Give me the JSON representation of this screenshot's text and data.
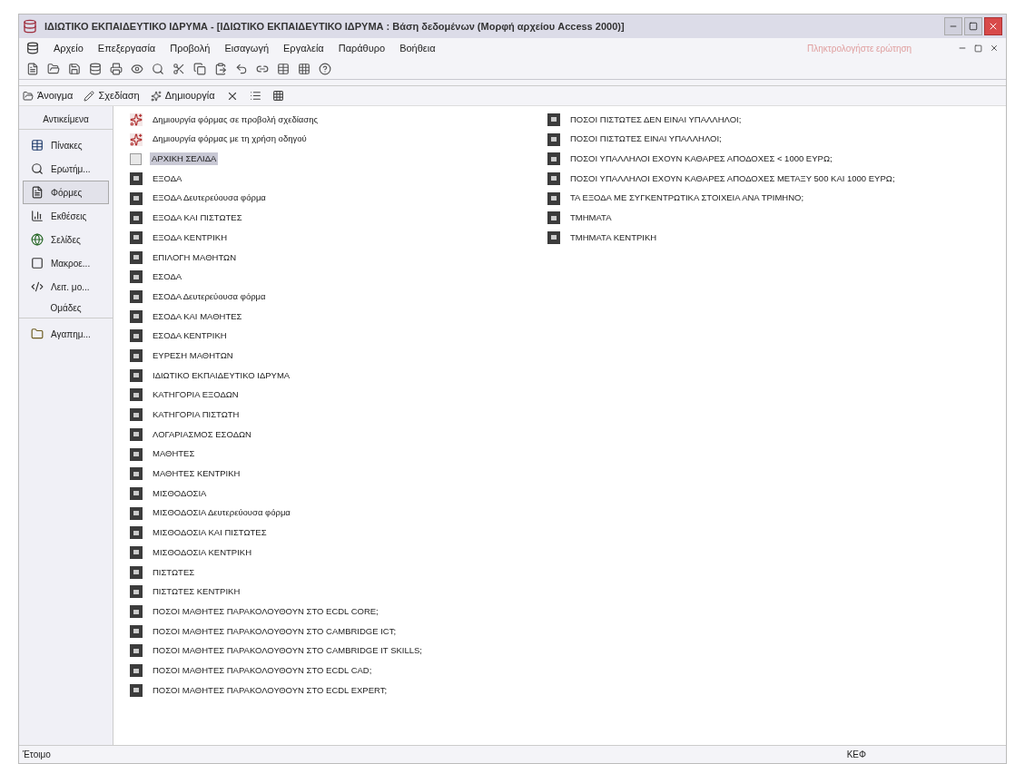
{
  "window": {
    "title": "ΙΔΙΩΤΙΚΟ ΕΚΠΑΙΔΕΥΤΙΚΟ ΙΔΡΥΜΑ - [ΙΔΙΩΤΙΚΟ ΕΚΠΑΙΔΕΥΤΙΚΟ ΙΔΡΥΜΑ : Βάση δεδομένων (Μορφή αρχείου Access 2000)]"
  },
  "menu": [
    "Αρχείο",
    "Επεξεργασία",
    "Προβολή",
    "Εισαγωγή",
    "Εργαλεία",
    "Παράθυρο",
    "Βοήθεια"
  ],
  "help_box": {
    "placeholder": "Πληκτρολογήστε ερώτηση"
  },
  "db_toolbar": [
    {
      "label": "Άνοιγμα",
      "kind": "open"
    },
    {
      "label": "Σχεδίαση",
      "kind": "design"
    },
    {
      "label": "Δημιουργία",
      "kind": "new"
    }
  ],
  "sidebar": [
    {
      "kind": "header",
      "label": "Αντικείμενα"
    },
    {
      "kind": "tables",
      "label": "Πίνακες",
      "selected": false
    },
    {
      "kind": "queries",
      "label": "Ερωτήμ...",
      "selected": false
    },
    {
      "kind": "forms",
      "label": "Φόρμες",
      "selected": true
    },
    {
      "kind": "reports",
      "label": "Εκθέσεις",
      "selected": false
    },
    {
      "kind": "pages",
      "label": "Σελίδες",
      "selected": false
    },
    {
      "kind": "macros",
      "label": "Μακροε...",
      "selected": false
    },
    {
      "kind": "modules",
      "label": "Λειτ. μο...",
      "selected": false
    },
    {
      "kind": "header",
      "label": "Ομάδες"
    },
    {
      "kind": "favorites",
      "label": "Αγαπημ...",
      "selected": false
    }
  ],
  "objects": [
    {
      "kind": "wizard",
      "label": "Δημιουργία φόρμας σε προβολή σχεδίασης",
      "selected": false
    },
    {
      "kind": "wizard",
      "label": "Δημιουργία φόρμας με τη χρήση οδηγού",
      "selected": false
    },
    {
      "kind": "switchboard",
      "label": "ΑΡΧΙΚΗ ΣΕΛΙΔΑ",
      "selected": true
    },
    {
      "kind": "form",
      "label": "ΕΞΟΔΑ",
      "selected": false
    },
    {
      "kind": "form",
      "label": "ΕΞΟΔΑ Δευτερεύουσα φόρμα",
      "selected": false
    },
    {
      "kind": "form",
      "label": "ΕΞΟΔΑ ΚΑΙ ΠΙΣΤΩΤΕΣ",
      "selected": false
    },
    {
      "kind": "form",
      "label": "ΕΞΟΔΑ ΚΕΝΤΡΙΚΗ",
      "selected": false
    },
    {
      "kind": "form",
      "label": "ΕΠΙΛΟΓΗ ΜΑΘΗΤΩΝ",
      "selected": false
    },
    {
      "kind": "form",
      "label": "ΕΣΟΔΑ",
      "selected": false
    },
    {
      "kind": "form",
      "label": "ΕΣΟΔΑ Δευτερεύουσα φόρμα",
      "selected": false
    },
    {
      "kind": "form",
      "label": "ΕΣΟΔΑ ΚΑΙ ΜΑΘΗΤΕΣ",
      "selected": false
    },
    {
      "kind": "form",
      "label": "ΕΣΟΔΑ ΚΕΝΤΡΙΚΗ",
      "selected": false
    },
    {
      "kind": "form",
      "label": "ΕΥΡΕΣΗ ΜΑΘΗΤΩΝ",
      "selected": false
    },
    {
      "kind": "form",
      "label": "ΙΔΙΩΤΙΚΟ ΕΚΠΑΙΔΕΥΤΙΚΟ ΙΔΡΥΜΑ",
      "selected": false
    },
    {
      "kind": "form",
      "label": "ΚΑΤΗΓΟΡΙΑ ΕΞΟΔΩΝ",
      "selected": false
    },
    {
      "kind": "form",
      "label": "ΚΑΤΗΓΟΡΙΑ ΠΙΣΤΩΤΗ",
      "selected": false
    },
    {
      "kind": "form",
      "label": "ΛΟΓΑΡΙΑΣΜΟΣ ΕΣΟΔΩΝ",
      "selected": false
    },
    {
      "kind": "form",
      "label": "ΜΑΘΗΤΕΣ",
      "selected": false
    },
    {
      "kind": "form",
      "label": "ΜΑΘΗΤΕΣ ΚΕΝΤΡΙΚΗ",
      "selected": false
    },
    {
      "kind": "form",
      "label": "ΜΙΣΘΟΔΟΣΙΑ",
      "selected": false
    },
    {
      "kind": "form",
      "label": "ΜΙΣΘΟΔΟΣΙΑ Δευτερεύουσα φόρμα",
      "selected": false
    },
    {
      "kind": "form",
      "label": "ΜΙΣΘΟΔΟΣΙΑ ΚΑΙ ΠΙΣΤΩΤΕΣ",
      "selected": false
    },
    {
      "kind": "form",
      "label": "ΜΙΣΘΟΔΟΣΙΑ ΚΕΝΤΡΙΚΗ",
      "selected": false
    },
    {
      "kind": "form",
      "label": "ΠΙΣΤΩΤΕΣ",
      "selected": false
    },
    {
      "kind": "form",
      "label": "ΠΙΣΤΩΤΕΣ ΚΕΝΤΡΙΚΗ",
      "selected": false
    },
    {
      "kind": "form",
      "label": "ΠΟΣΟΙ ΜΑΘΗΤΕΣ ΠΑΡΑΚΟΛΟΥΘΟΥΝ ΣΤΟ ECDL CORE;",
      "selected": false
    },
    {
      "kind": "form",
      "label": "ΠΟΣΟΙ ΜΑΘΗΤΕΣ ΠΑΡΑΚΟΛΟΥΘΟΥΝ ΣΤΟ CAMBRIDGE ICT;",
      "selected": false
    },
    {
      "kind": "form",
      "label": "ΠΟΣΟΙ ΜΑΘΗΤΕΣ ΠΑΡΑΚΟΛΟΥΘΟΥΝ ΣΤΟ CAMBRIDGE IT SKILLS;",
      "selected": false
    },
    {
      "kind": "form",
      "label": "ΠΟΣΟΙ ΜΑΘΗΤΕΣ ΠΑΡΑΚΟΛΟΥΘΟΥΝ ΣΤΟ ECDL CAD;",
      "selected": false
    },
    {
      "kind": "form",
      "label": "ΠΟΣΟΙ ΜΑΘΗΤΕΣ ΠΑΡΑΚΟΛΟΥΘΟΥΝ ΣΤΟ ECDL EXPERT;",
      "selected": false
    },
    {
      "kind": "form",
      "label": "ΠΟΣΟΙ ΠΙΣΤΩΤΕΣ ΔΕΝ ΕΙΝΑΙ ΥΠΑΛΛΗΛΟΙ;",
      "selected": false
    },
    {
      "kind": "form",
      "label": "ΠΟΣΟΙ ΠΙΣΤΩΤΕΣ ΕΙΝΑΙ ΥΠΑΛΛΗΛΟΙ;",
      "selected": false
    },
    {
      "kind": "form",
      "label": "ΠΟΣΟΙ ΥΠΑΛΛΗΛΟΙ ΕΧΟΥΝ ΚΑΘΑΡΕΣ ΑΠΟΔΟΧΕΣ < 1000 ΕΥΡΩ;",
      "selected": false
    },
    {
      "kind": "form",
      "label": "ΠΟΣΟΙ ΥΠΑΛΛΗΛΟΙ ΕΧΟΥΝ ΚΑΘΑΡΕΣ ΑΠΟΔΟΧΕΣ ΜΕΤΑΞΥ 500 ΚΑΙ 1000 ΕΥΡΩ;",
      "selected": false
    },
    {
      "kind": "form",
      "label": "ΤΑ ΕΞΟΔΑ ΜΕ ΣΥΓΚΕΝΤΡΩΤΙΚΑ ΣΤΟΙΧΕΙΑ ΑΝΑ ΤΡΙΜΗΝΟ;",
      "selected": false
    },
    {
      "kind": "form",
      "label": "ΤΜΗΜΑΤΑ",
      "selected": false
    },
    {
      "kind": "form",
      "label": "ΤΜΗΜΑΤΑ ΚΕΝΤΡΙΚΗ",
      "selected": false
    }
  ],
  "status_bar": {
    "left": "Έτοιμο",
    "right": "ΚΕΦ"
  }
}
